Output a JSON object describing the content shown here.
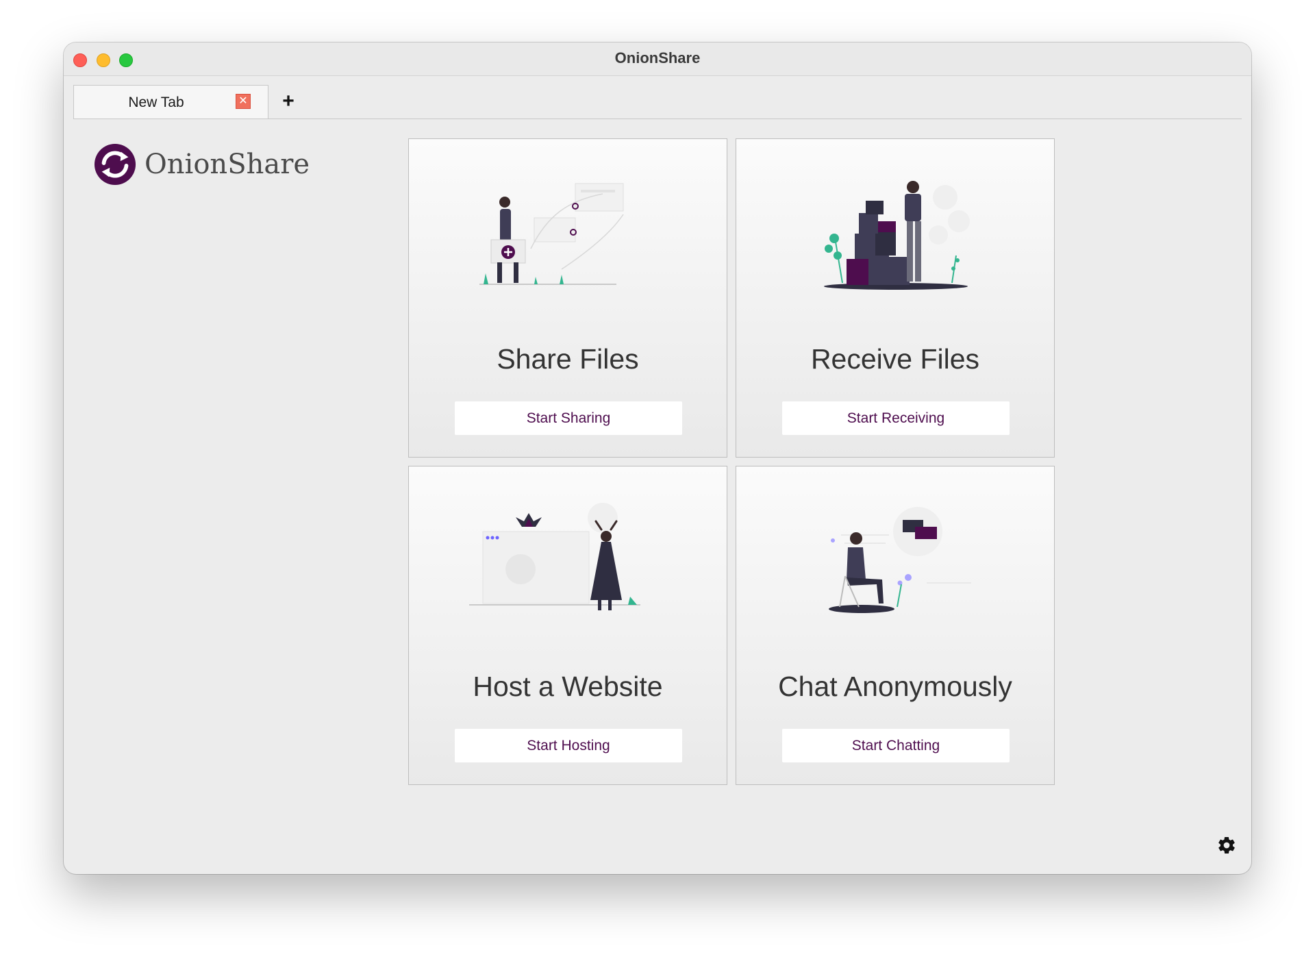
{
  "window": {
    "title": "OnionShare"
  },
  "tabs": [
    {
      "label": "New Tab",
      "close_icon": "close-icon"
    }
  ],
  "new_tab_icon": "plus-icon",
  "logo": {
    "text": "OnionShare",
    "icon": "onionshare-logo-icon"
  },
  "modes": [
    {
      "title": "Share Files",
      "button": "Start Sharing"
    },
    {
      "title": "Receive Files",
      "button": "Start Receiving"
    },
    {
      "title": "Host a Website",
      "button": "Start Hosting"
    },
    {
      "title": "Chat Anonymously",
      "button": "Start Chatting"
    }
  ],
  "settings_icon": "gear-icon",
  "colors": {
    "brand_purple": "#4e0d4e",
    "accent_green": "#33b58f",
    "window_bg": "#ececec",
    "tab_close": "#f0705d"
  }
}
